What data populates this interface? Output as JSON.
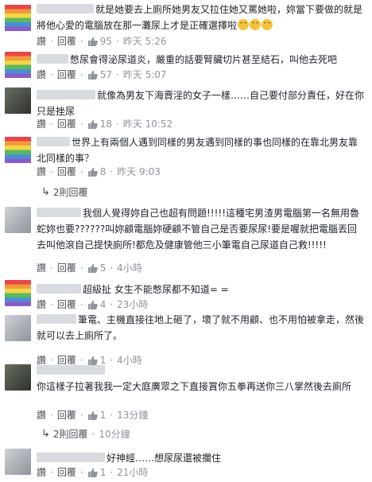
{
  "comments": [
    {
      "avatar": "rainbow",
      "text": "就是她要去上廁所她男友又拉住她又罵她啦，妳當下要做的就是將他心愛的電腦放在那一灘尿上才是正確選擇啦",
      "like_label": "讚",
      "reply_label": "回覆",
      "likes": "95",
      "time": "昨天 5:26"
    },
    {
      "avatar": "rainbow",
      "text": "憋尿會得泌尿道炎，嚴重的話要腎臟切片甚至結石，叫他去死吧",
      "like_label": "讚",
      "reply_label": "回覆",
      "likes": "57",
      "time": "昨天 5:07"
    },
    {
      "avatar": "dark",
      "text": "就像為男友下海賣淫的女子一樣……自己要付部分責任，好在你只是挫尿",
      "like_label": "讚",
      "reply_label": "回覆",
      "likes": "18",
      "time": "昨天 10:52"
    },
    {
      "avatar": "rainbow",
      "text": "世界上有兩個人遇到同樣的男友遇到同樣的事也同樣的在靠北男友靠北同樣的事？",
      "like_label": "讚",
      "reply_label": "回覆",
      "likes": "8",
      "time": "昨天 9:03",
      "replies_label": "2則回覆"
    },
    {
      "avatar": "gray",
      "text": "我個人覺得妳自己也超有問題!!!!!這種宅男渣男電腦第一名無用魯蛇妳也要??????叫妳顧電腦妳硬顧不管自己是否要尿尿!要是喔就把電腦丟回去叫他滾自己提快廁所!都危及健康管他三小筆電自己尿道自己救!!!!!",
      "like_label": "讚",
      "reply_label": "回覆",
      "likes": "5",
      "time": "4小時"
    },
    {
      "avatar": "rainbow",
      "text": "超級扯 女生不能憋尿都不知道= =",
      "like_label": "讚",
      "reply_label": "回覆",
      "likes": "4",
      "time": "23小時"
    },
    {
      "avatar": "gray",
      "text": "筆電、主機直接往地上砸了，壞了就不用顧、也不用怕被拿走，然後就可以去上廁所了。",
      "like_label": "讚",
      "reply_label": "回覆",
      "likes": "1",
      "time": "4小時"
    },
    {
      "avatar": "dark",
      "text": "你這樣子拉著我我一定大庭廣眾之下直接賞你五拳再送你三八掌然後去廁所",
      "like_label": "讚",
      "reply_label": "回覆",
      "likes": "1",
      "time": "13分鐘",
      "nested_reply_label": "回覆",
      "nested_replies": "2則回覆",
      "nested_time": "10分鐘"
    },
    {
      "avatar": "gray",
      "text": "好神經……想尿尿還被攔住",
      "like_label": "讚",
      "reply_label": "回覆",
      "likes": "1",
      "time": "21小時"
    }
  ]
}
